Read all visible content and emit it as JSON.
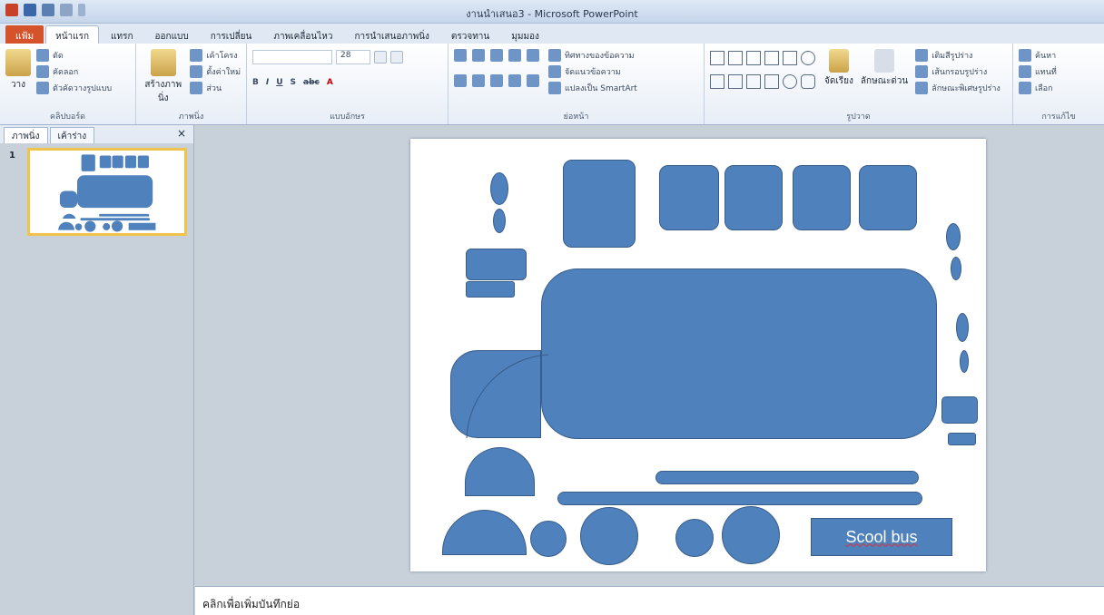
{
  "window": {
    "title": "งานนำเสนอ3 - Microsoft PowerPoint"
  },
  "tabs": [
    "แฟ้ม",
    "หน้าแรก",
    "แทรก",
    "ออกแบบ",
    "การเปลี่ยน",
    "ภาพเคลื่อนไหว",
    "การนำเสนอภาพนิ่ง",
    "ตรวจทาน",
    "มุมมอง"
  ],
  "ribbon": {
    "clipboard": {
      "label": "คลิปบอร์ด",
      "paste": "วาง",
      "cut": "ตัด",
      "copy": "คัดลอก",
      "format_painter": "ตัวคัดวางรูปแบบ"
    },
    "slides": {
      "label": "ภาพนิ่ง",
      "new_slide": "สร้างภาพนิ่ง",
      "layout": "เค้าโครง",
      "reset": "ตั้งค่าใหม่",
      "section": "ส่วน"
    },
    "font": {
      "label": "แบบอักษร",
      "size": "28"
    },
    "paragraph": {
      "label": "ย่อหน้า",
      "text_direction": "ทิศทางของข้อความ",
      "align_text": "จัดแนวข้อความ",
      "smartart": "แปลงเป็น SmartArt"
    },
    "drawing": {
      "label": "รูปวาด",
      "arrange": "จัดเรียง",
      "quick_styles": "ลักษณะด่วน",
      "shape_fill": "เติมสีรูปร่าง",
      "shape_outline": "เส้นกรอบรูปร่าง",
      "shape_effects": "ลักษณะพิเศษรูปร่าง"
    },
    "editing": {
      "label": "การแก้ไข",
      "find": "ค้นหา",
      "replace": "แทนที่",
      "select": "เลือก"
    }
  },
  "left_pane": {
    "tabs": [
      "ภาพนิ่ง",
      "เค้าร่าง"
    ],
    "close": "×",
    "slide_number": "1"
  },
  "slide": {
    "label_text": "Scool bus",
    "thumb_label": "Scool bus"
  },
  "notes": {
    "placeholder": "คลิกเพื่อเพิ่มบันทึกย่อ"
  },
  "colors": {
    "shape_fill": "#4f81bd",
    "shape_border": "#385d8a",
    "file_tab": "#d4532a"
  }
}
